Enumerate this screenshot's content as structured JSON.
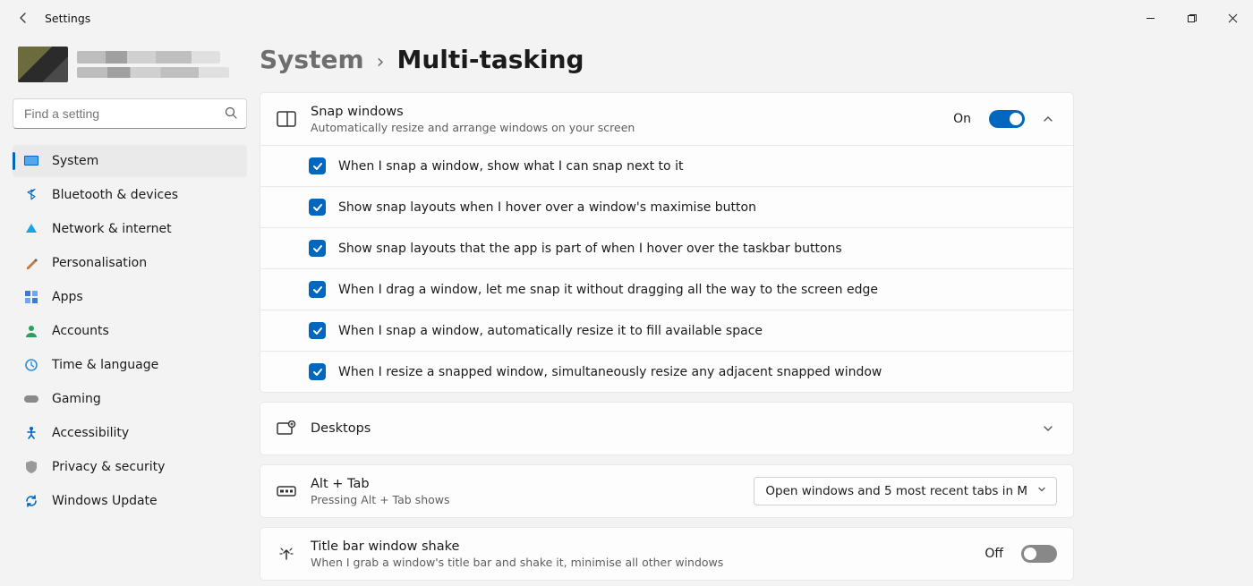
{
  "window": {
    "title": "Settings"
  },
  "search": {
    "placeholder": "Find a setting"
  },
  "nav": {
    "items": [
      {
        "label": "System"
      },
      {
        "label": "Bluetooth & devices"
      },
      {
        "label": "Network & internet"
      },
      {
        "label": "Personalisation"
      },
      {
        "label": "Apps"
      },
      {
        "label": "Accounts"
      },
      {
        "label": "Time & language"
      },
      {
        "label": "Gaming"
      },
      {
        "label": "Accessibility"
      },
      {
        "label": "Privacy & security"
      },
      {
        "label": "Windows Update"
      }
    ]
  },
  "breadcrumb": {
    "parent": "System",
    "sep": "›",
    "current": "Multi-tasking"
  },
  "snap": {
    "title": "Snap windows",
    "sub": "Automatically resize and arrange windows on your screen",
    "state_label": "On",
    "options": [
      "When I snap a window, show what I can snap next to it",
      "Show snap layouts when I hover over a window's maximise button",
      "Show snap layouts that the app is part of when I hover over the taskbar buttons",
      "When I drag a window, let me snap it without dragging all the way to the screen edge",
      "When I snap a window, automatically resize it to fill available space",
      "When I resize a snapped window, simultaneously resize any adjacent snapped window"
    ]
  },
  "desktops": {
    "title": "Desktops"
  },
  "alttab": {
    "title": "Alt + Tab",
    "sub": "Pressing Alt + Tab shows",
    "selected": "Open windows and 5 most recent tabs in M"
  },
  "shake": {
    "title": "Title bar window shake",
    "sub": "When I grab a window's title bar and shake it, minimise all other windows",
    "state_label": "Off"
  }
}
